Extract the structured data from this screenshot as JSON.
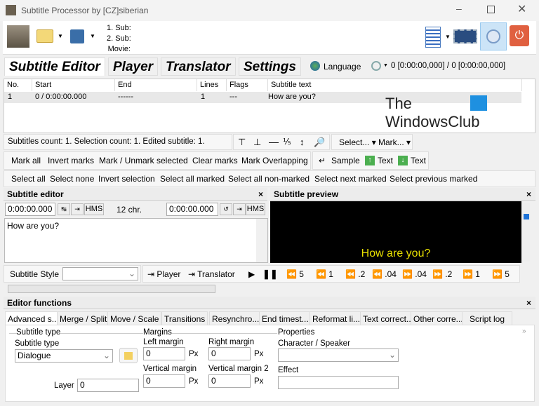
{
  "window": {
    "title": "Subtitle Processor by [CZ]siberian"
  },
  "toolbar": {
    "sub1": "1. Sub:",
    "sub2": "2. Sub:",
    "movie": "Movie:"
  },
  "tabs": [
    "Subtitle Editor",
    "Player",
    "Translator",
    "Settings"
  ],
  "language_label": "Language",
  "time_readout": "0 [0:00:00,000] / 0 [0:00:00,000]",
  "table": {
    "columns": [
      "No.",
      "Start",
      "End",
      "Lines",
      "Flags",
      "Subtitle text"
    ],
    "rows": [
      {
        "no": "1",
        "start": "0 / 0:00:00.000",
        "end": "------",
        "lines": "1",
        "flags": "---",
        "text": "How are you?"
      }
    ]
  },
  "watermark": {
    "line1": "The",
    "line2": "WindowsClub"
  },
  "status": "Subtitles count: 1.   Selection count: 1.   Edited subtitle: 1.",
  "select_menu": "Select...",
  "mark_menu": "Mark...",
  "mark_buttons": [
    "Mark all",
    "Invert marks",
    "Mark / Unmark selected",
    "Clear marks",
    "Mark Overlapping"
  ],
  "sample_buttons": [
    "Sample",
    "Text",
    "Text"
  ],
  "select_buttons": [
    "Select all",
    "Select none",
    "Invert selection",
    "Select all marked",
    "Select all non-marked",
    "Select next marked",
    "Select previous marked"
  ],
  "editor": {
    "title": "Subtitle editor",
    "start": "0:00:00.000",
    "end": "0:00:00.000",
    "hms": "HMS",
    "chars": "12 chr.",
    "text": "How are you?",
    "style_label": "Subtitle Style",
    "style_value": ""
  },
  "preview": {
    "title": "Subtitle preview",
    "text": "How are you?"
  },
  "playback": {
    "player": "Player",
    "translator": "Translator",
    "steps": [
      "5",
      "1",
      ".2",
      ".04",
      ".04",
      ".2",
      "1",
      "5"
    ]
  },
  "functions": {
    "title": "Editor functions",
    "tabs": [
      "Advanced s...",
      "Merge / Split",
      "Move / Scale",
      "Transitions",
      "Resynchro...",
      "End timest...",
      "Reformat li...",
      "Text correct...",
      "Other corre...",
      "Script log"
    ],
    "subtitle_type_group": "Subtitle type",
    "subtitle_type_label": "Subtitle type",
    "subtitle_type_value": "Dialogue",
    "layer_label": "Layer",
    "layer_value": "0",
    "margins_group": "Margins",
    "left_margin": "Left margin",
    "right_margin": "Right margin",
    "vertical_margin": "Vertical margin",
    "vertical_margin2": "Vertical margin 2",
    "left_value": "0",
    "right_value": "0",
    "vert_value": "0",
    "vert2_value": "0",
    "px": "Px",
    "properties_group": "Properties",
    "speaker_label": "Character / Speaker",
    "speaker_value": "",
    "effect_label": "Effect",
    "effect_value": ""
  }
}
